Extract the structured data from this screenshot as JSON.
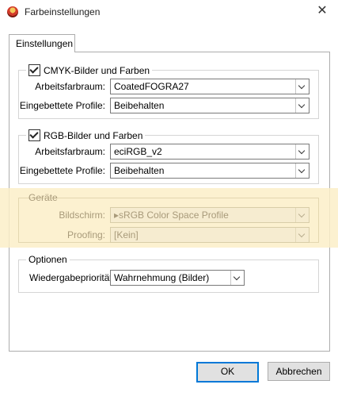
{
  "window": {
    "title": "Farbeinstellungen",
    "close_glyph": "✕"
  },
  "tabs": [
    {
      "label": "Einstellungen"
    }
  ],
  "cmyk": {
    "label": "CMYK-Bilder und Farben",
    "checked": true,
    "workspace_label": "Arbeitsfarbraum:",
    "workspace_value": "CoatedFOGRA27",
    "embedded_label": "Eingebettete Profile:",
    "embedded_value": "Beibehalten"
  },
  "rgb": {
    "label": "RGB-Bilder und Farben",
    "checked": true,
    "workspace_label": "Arbeitsfarbraum:",
    "workspace_value": "eciRGB_v2",
    "embedded_label": "Eingebettete Profile:",
    "embedded_value": "Beibehalten"
  },
  "devices": {
    "label": "Geräte",
    "screen_label": "Bildschirm:",
    "screen_value": "sRGB Color Space Profile",
    "proofing_label": "Proofing:",
    "proofing_value": "[Kein]"
  },
  "options": {
    "label": "Optionen",
    "rendering_label": "Wiedergabepriorität:",
    "rendering_value": "Wahrnehmung (Bilder)"
  },
  "buttons": {
    "ok": "OK",
    "cancel": "Abbrechen"
  },
  "colors": {
    "highlight": "#fbeec8",
    "accent": "#0078d7"
  }
}
